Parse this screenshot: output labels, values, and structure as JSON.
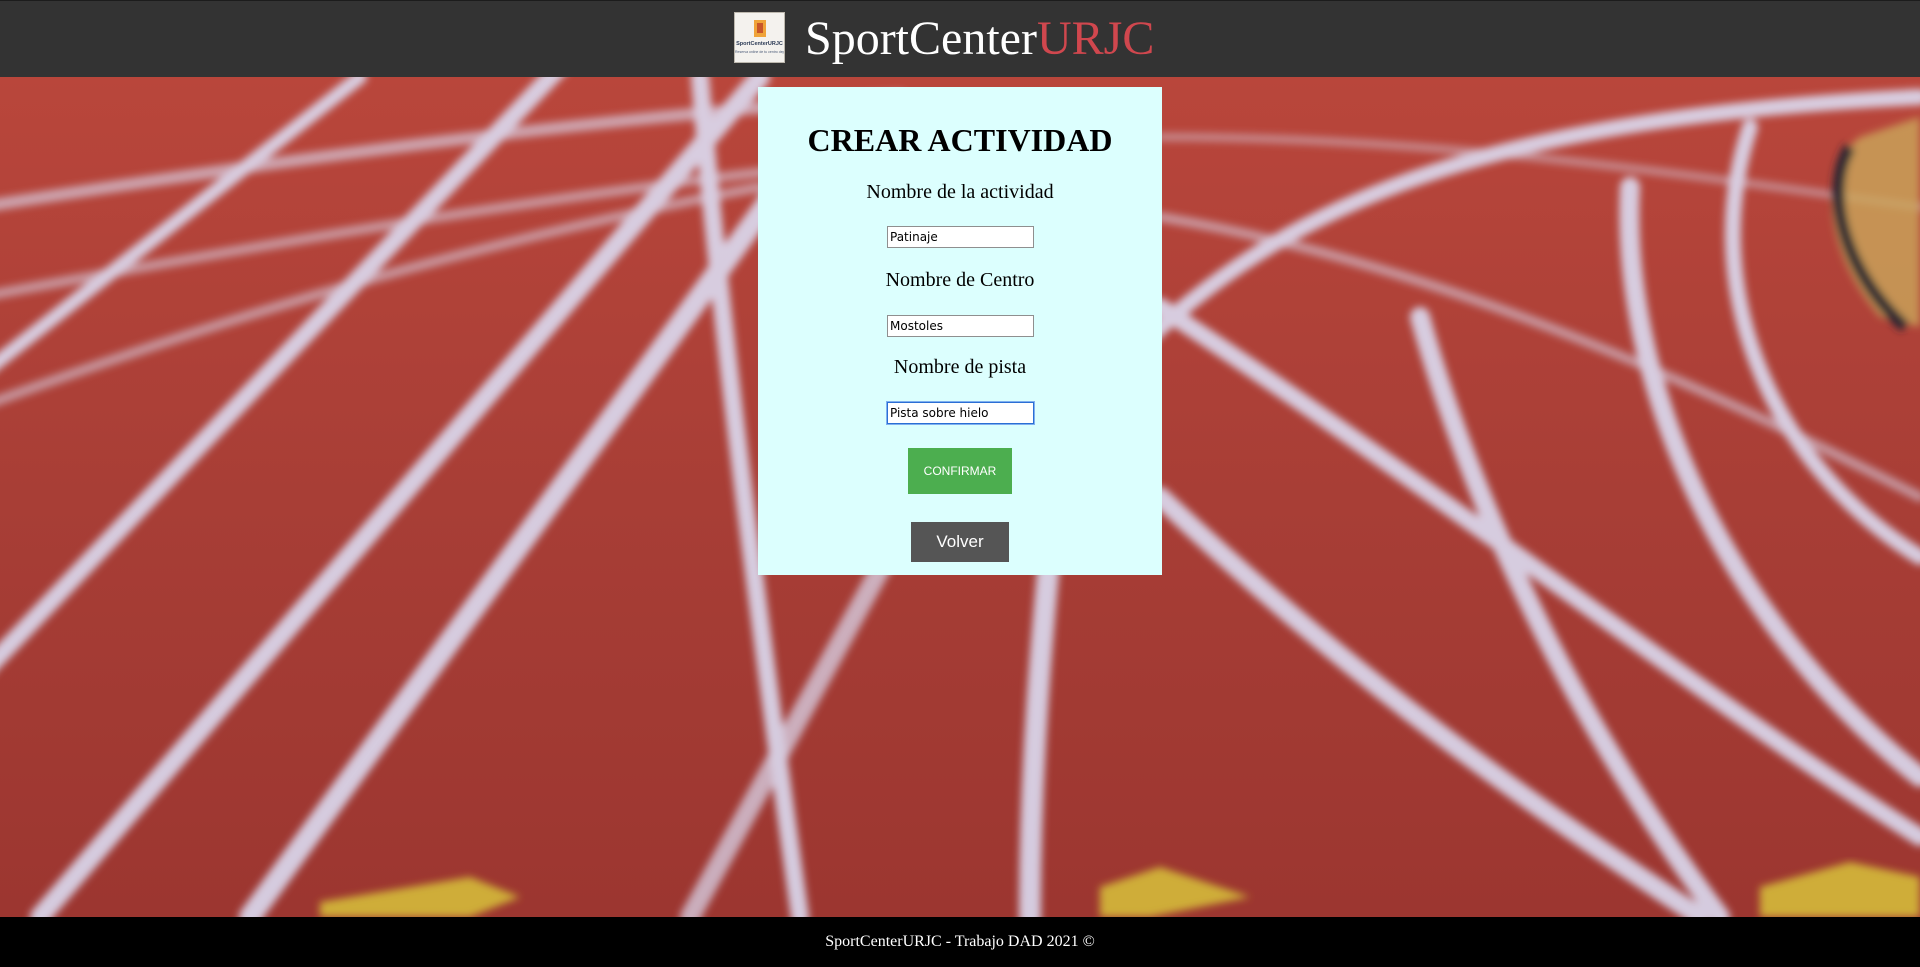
{
  "header": {
    "brand_part1": "SportCenter",
    "brand_part2": "URJC",
    "logo_text_1": "SportCenterURJC",
    "logo_text_2": "Reserva online de tu centro deportivo"
  },
  "form": {
    "title": "CREAR ACTIVIDAD",
    "fields": [
      {
        "label": "Nombre de la actividad",
        "value": "Patinaje"
      },
      {
        "label": "Nombre de Centro",
        "value": "Mostoles"
      },
      {
        "label": "Nombre de pista",
        "value": "Pista sobre hielo"
      }
    ],
    "confirm_label": "CONFIRMAR",
    "back_label": "Volver"
  },
  "footer": {
    "text": "SportCenterURJC - Trabajo DAD 2021 ©"
  },
  "colors": {
    "header_bg": "#333333",
    "brand_accent": "#d0474e",
    "card_bg": "#dcfffe",
    "confirm_bg": "#4cae4f",
    "back_bg": "#555555",
    "footer_bg": "#000000",
    "track": "#a83e36"
  }
}
